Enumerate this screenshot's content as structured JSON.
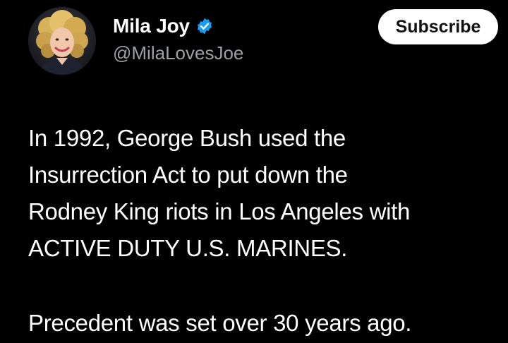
{
  "author": {
    "display_name": "Mila Joy",
    "handle": "@MilaLovesJoe",
    "verified": true
  },
  "actions": {
    "subscribe_label": "Subscribe"
  },
  "post": {
    "paragraph1": [
      "In 1992, George Bush used the",
      "Insurrection Act to put down the",
      "Rodney King riots in Los Angeles with",
      "ACTIVE DUTY U.S. MARINES."
    ],
    "paragraph2": "Precedent was set over 30 years ago."
  },
  "colors": {
    "background": "#000000",
    "text": "#ffffff",
    "secondary_text": "#9aa0a6",
    "verified_badge": "#1d9bf0",
    "subscribe_bg": "#ffffff"
  },
  "icons": {
    "verified": "verified-badge-icon",
    "avatar": "profile-photo"
  }
}
